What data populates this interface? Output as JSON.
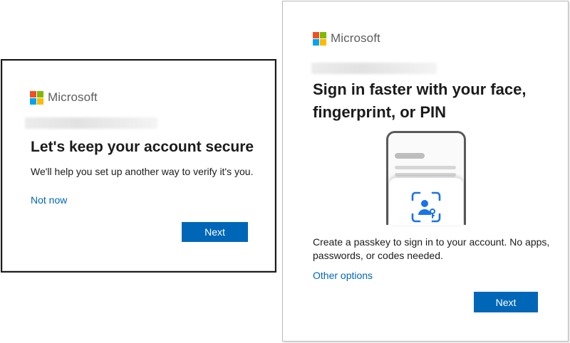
{
  "left_dialog": {
    "brand": "Microsoft",
    "title": "Let's keep your account secure",
    "description": "We'll help you set up another way to verify it's you.",
    "not_now_link": "Not now",
    "next_button": "Next"
  },
  "right_dialog": {
    "brand": "Microsoft",
    "title_line1": "Sign in faster with your face,",
    "title_line2": "fingerprint, or PIN",
    "description_line1": "Create a passkey to sign in to your account. No apps,",
    "description_line2": "passwords, or codes needed.",
    "other_options_link": "Other options",
    "next_button": "Next",
    "illustration_icon": "face-scan-icon"
  },
  "colors": {
    "accent": "#0067b8",
    "logo_red": "#f25022",
    "logo_green": "#7fba00",
    "logo_blue": "#00a4ef",
    "logo_yellow": "#ffb900",
    "icon_blue": "#1a73e8"
  }
}
